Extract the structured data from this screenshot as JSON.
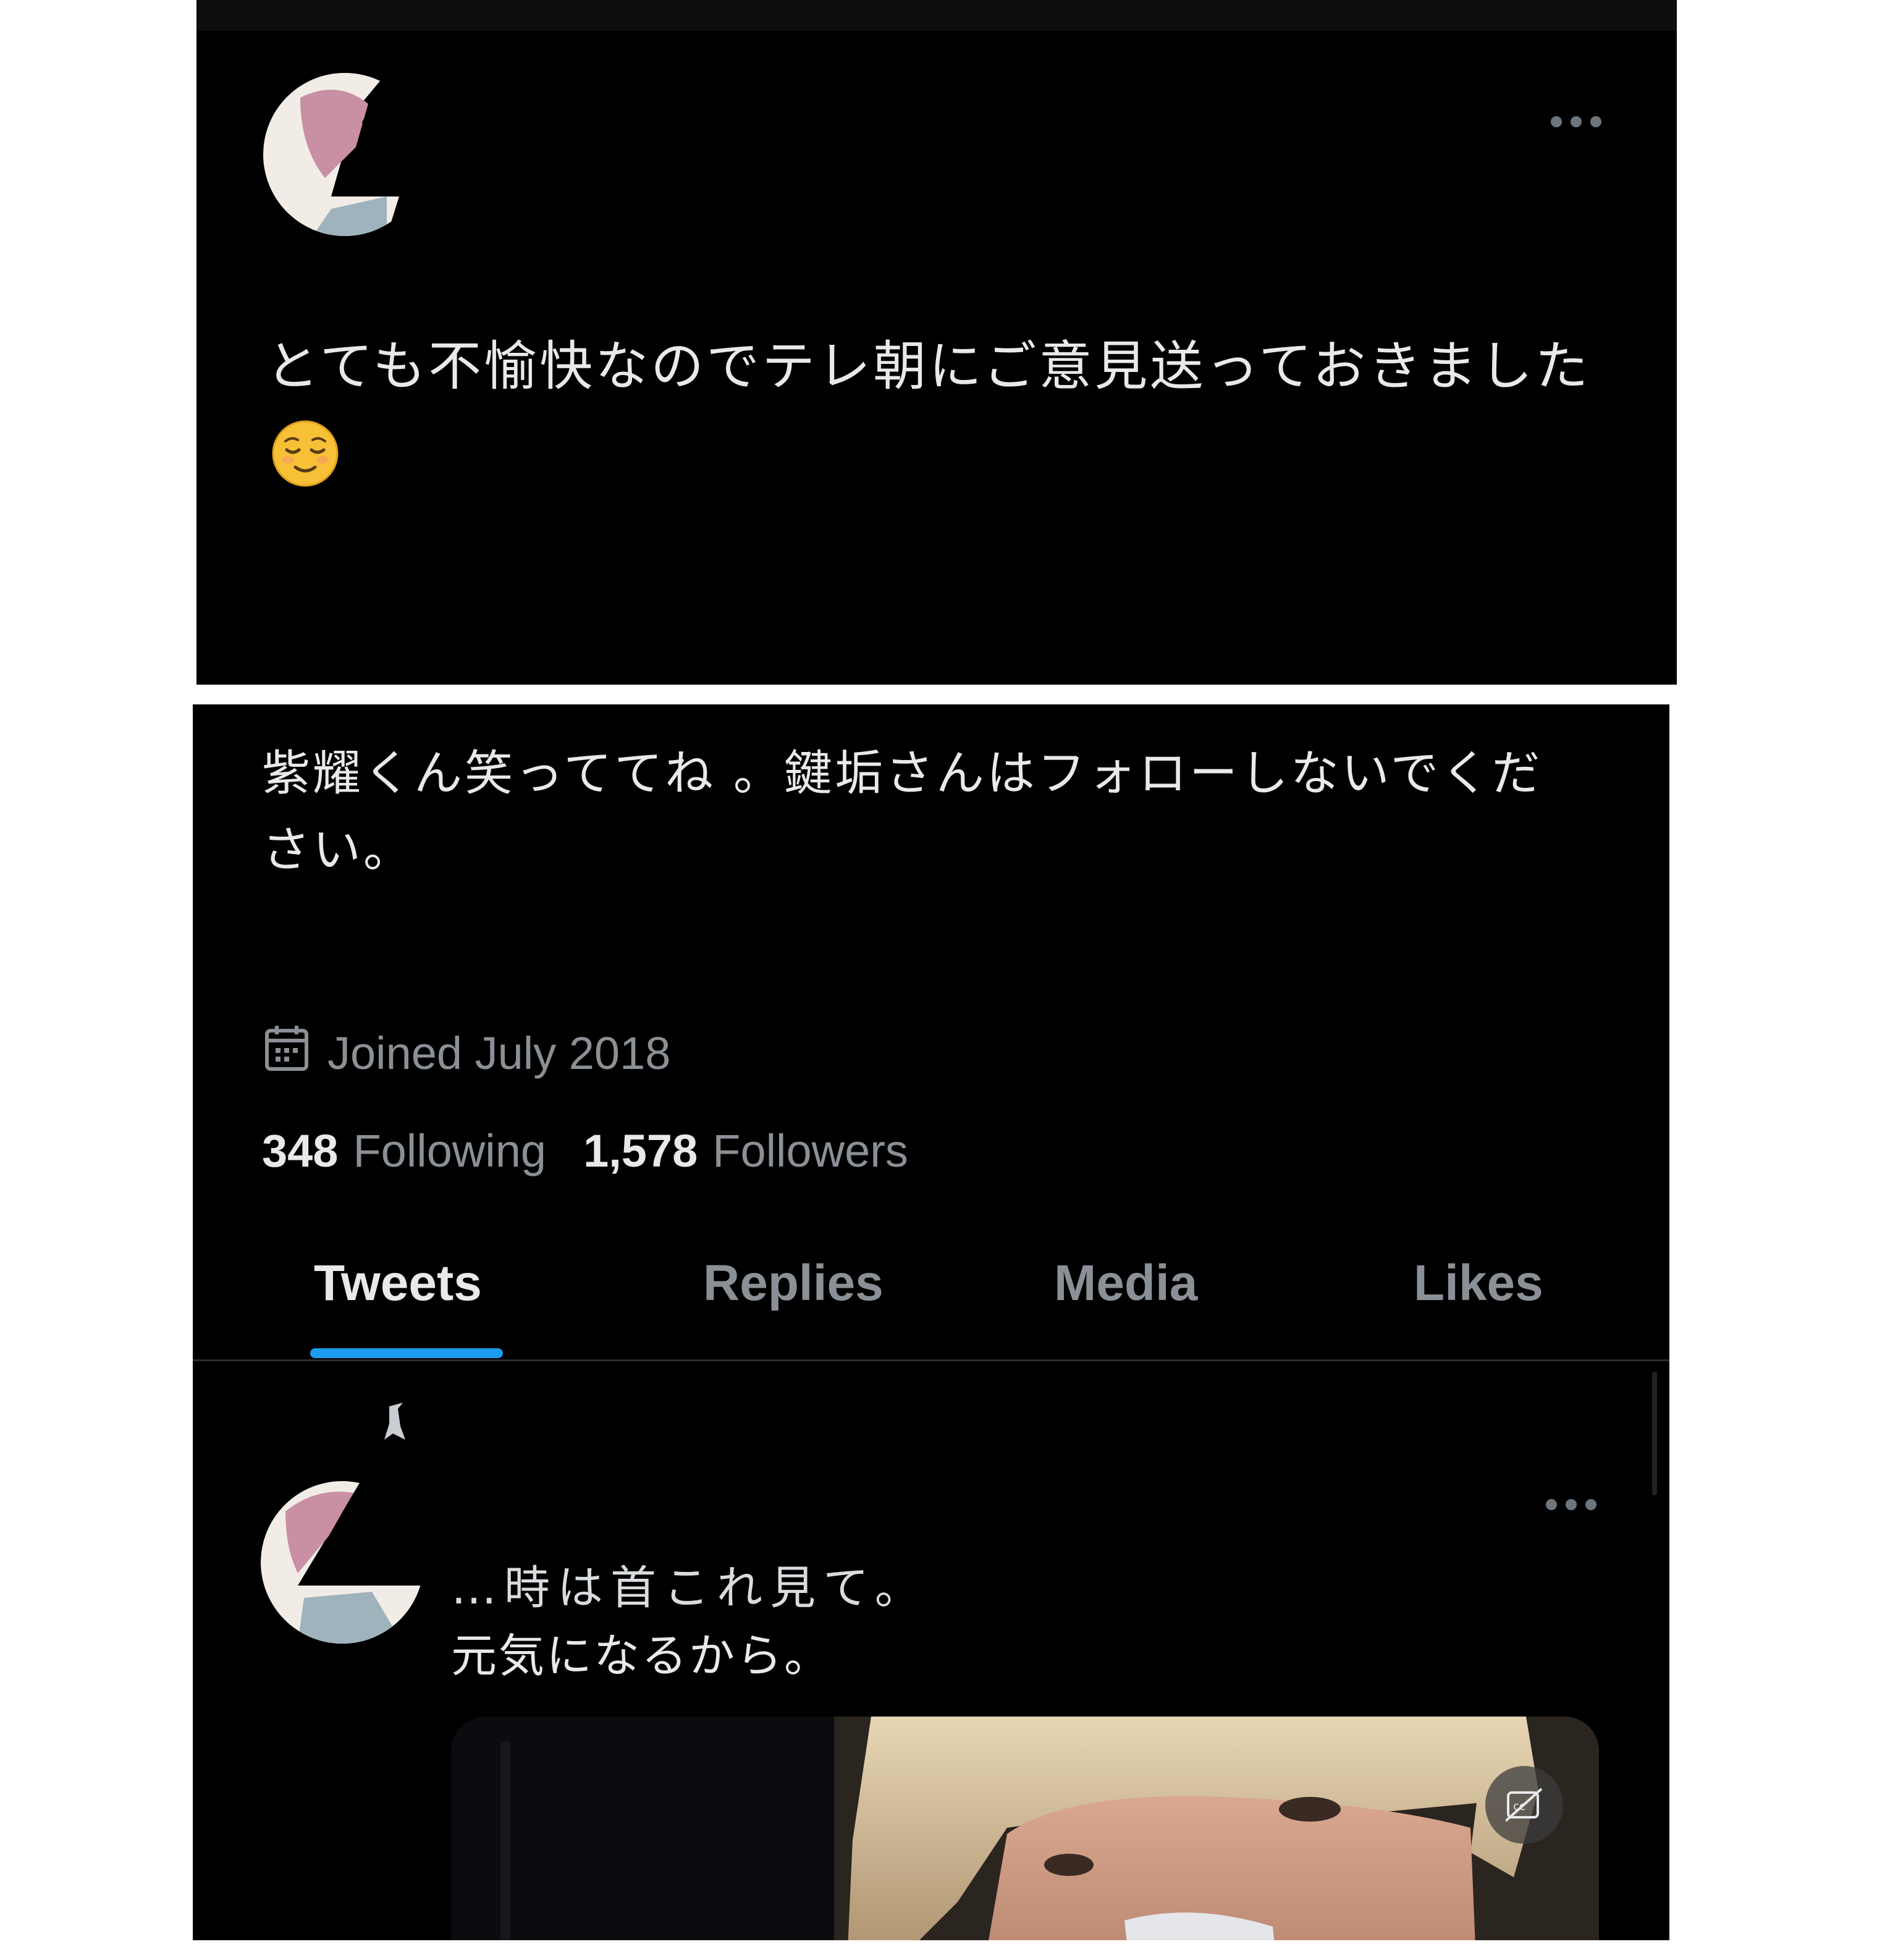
{
  "top_tweet": {
    "text": "とても不愉快なのでテレ朝にご意見送っておきました",
    "emoji": "relieved-face"
  },
  "profile": {
    "bio_line1": "紫耀くん笑っててね 。鍵垢さんはフォローしないでくだ",
    "bio_line2": "さい。",
    "joined": "Joined July 2018",
    "following_count": "348",
    "following_label": "Following",
    "followers_count": "1,578",
    "followers_label": "Followers"
  },
  "tabs": [
    {
      "label": "Tweets",
      "active": true
    },
    {
      "label": "Replies",
      "active": false
    },
    {
      "label": "Media",
      "active": false
    },
    {
      "label": "Likes",
      "active": false
    }
  ],
  "feed_tweet": {
    "partial_line": "…時は首これ見て。",
    "line2": "元気になるから。"
  },
  "colors": {
    "background": "#000000",
    "text_primary": "#e7e9ea",
    "text_secondary": "#8b9096",
    "accent": "#1d9bf0"
  },
  "icons": [
    "more-icon",
    "calendar-icon",
    "captions-off-icon",
    "retweet-icon"
  ]
}
